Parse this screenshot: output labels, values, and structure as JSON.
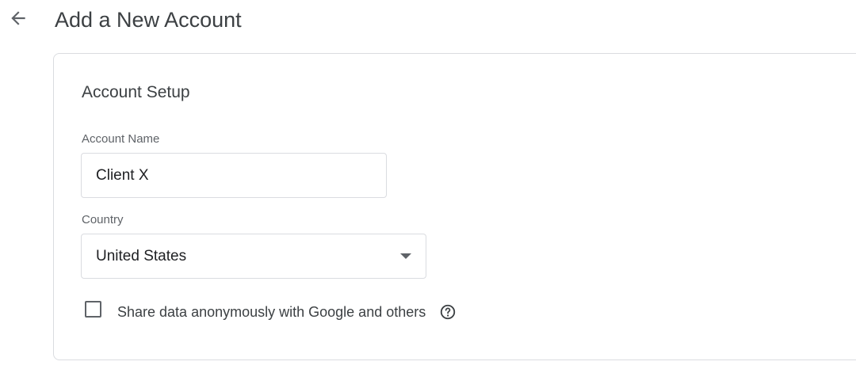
{
  "header": {
    "back_icon": "arrow-back-icon",
    "title": "Add a New Account"
  },
  "account_setup": {
    "section_title": "Account Setup",
    "account_name": {
      "label": "Account Name",
      "value": "Client X"
    },
    "country": {
      "label": "Country",
      "selected": "United States",
      "caret_icon": "dropdown-caret-icon"
    },
    "share_data": {
      "checked": false,
      "label": "Share data anonymously with Google and others",
      "help_icon": "help-circle-icon"
    }
  }
}
